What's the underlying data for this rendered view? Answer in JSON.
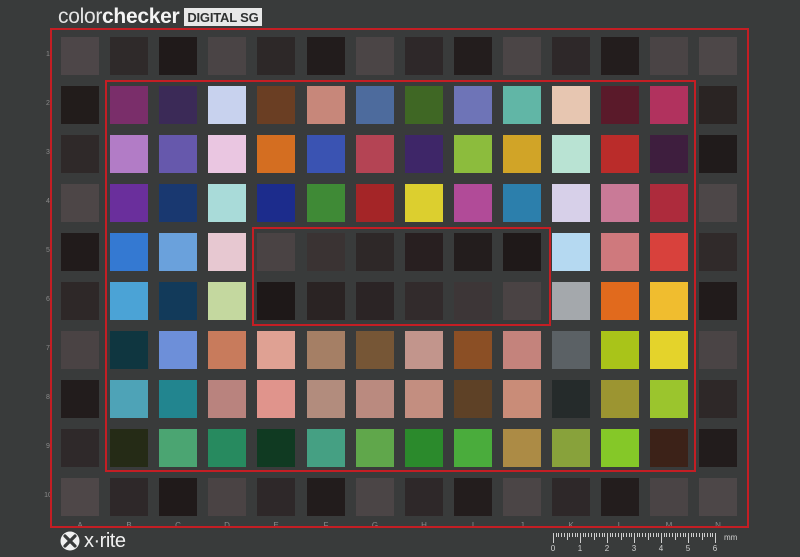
{
  "brand": {
    "prefix": "color",
    "name": "checker",
    "badge": "DIGITAL SG"
  },
  "logo": {
    "text": "x·rite"
  },
  "ruler": {
    "unit": "mm",
    "numbers": [
      "0",
      "1",
      "2",
      "3",
      "4",
      "5",
      "6"
    ]
  },
  "columns": [
    "A",
    "B",
    "C",
    "D",
    "E",
    "F",
    "G",
    "H",
    "I",
    "J",
    "K",
    "L",
    "M",
    "N"
  ],
  "rows": [
    "1",
    "2",
    "3",
    "4",
    "5",
    "6",
    "7",
    "8",
    "9",
    "10"
  ],
  "colors": {
    "background": "#393b3b",
    "outline": "#c41e24"
  },
  "patches": [
    [
      "#4d4648",
      "#2f2a2a",
      "#201a1a",
      "#4a4445",
      "#2d2828",
      "#221c1c",
      "#4b4546",
      "#2e2829",
      "#231d1d",
      "#4b4546",
      "#2e2829",
      "#231d1d",
      "#4a4445",
      "#4d4748"
    ],
    [
      "#221c1b",
      "#7a2e6a",
      "#3b2a57",
      "#c8d2ee",
      "#6a3e23",
      "#c7877a",
      "#4d6b9d",
      "#3f6724",
      "#6e74b7",
      "#61b6a6",
      "#e7c6b1",
      "#5a1a2a",
      "#b1325e",
      "#2a2423"
    ],
    [
      "#2f2929",
      "#b27cc6",
      "#6658ac",
      "#eac6e1",
      "#d46e21",
      "#3a53b2",
      "#b44454",
      "#3e2668",
      "#8cbc3d",
      "#d1a427",
      "#b9e3d3",
      "#ba2c2a",
      "#3e1e3e",
      "#201b1b"
    ],
    [
      "#4d4647",
      "#6a2f9c",
      "#193870",
      "#a9dbd9",
      "#1c2c8c",
      "#3f8a36",
      "#a42527",
      "#dccf2f",
      "#b14b98",
      "#2c7fac",
      "#d7d0e9",
      "#c97a97",
      "#ad2b3c",
      "#4d4748"
    ],
    [
      "#211b1b",
      "#3479d2",
      "#6aa1dc",
      "#e7c8d1",
      "#4a4344",
      "#3a3333",
      "#2e2828",
      "#281f20",
      "#231d1d",
      "#1f1919",
      "#b5d9f1",
      "#cf797d",
      "#d8413c",
      "#302a2a"
    ],
    [
      "#2e2828",
      "#4ba3d6",
      "#123a5a",
      "#c4d89f",
      "#1e1818",
      "#2a2323",
      "#2b2425",
      "#322b2c",
      "#3d3637",
      "#4a4344",
      "#a4a8ac",
      "#e16a1d",
      "#f0bd2f",
      "#211b1b"
    ],
    [
      "#4a4344",
      "#0f3640",
      "#6d8fd9",
      "#c87b5c",
      "#dfa193",
      "#a57f65",
      "#765636",
      "#c2958c",
      "#8b4f25",
      "#c4837c",
      "#5b6165",
      "#a9c419",
      "#e4d32b",
      "#4a4445"
    ],
    [
      "#221c1c",
      "#4ea3b7",
      "#22858f",
      "#b9837e",
      "#e0948c",
      "#b28c7d",
      "#ba8a7f",
      "#c38e80",
      "#5e4126",
      "#c98c78",
      "#252b2b",
      "#9c9531",
      "#9bc52d",
      "#2e2828"
    ],
    [
      "#2f292a",
      "#252b16",
      "#4ba572",
      "#278a5f",
      "#103a22",
      "#45a083",
      "#60a74b",
      "#2b8a2c",
      "#4aac3c",
      "#ac8b45",
      "#88a23b",
      "#85c828",
      "#3c2218",
      "#221c1c"
    ],
    [
      "#4e4748",
      "#2e2829",
      "#201a1a",
      "#4a4344",
      "#2e2829",
      "#221c1c",
      "#4b4546",
      "#2e2829",
      "#231d1d",
      "#4b4546",
      "#2e2829",
      "#231d1d",
      "#4a4445",
      "#4d4748"
    ]
  ]
}
